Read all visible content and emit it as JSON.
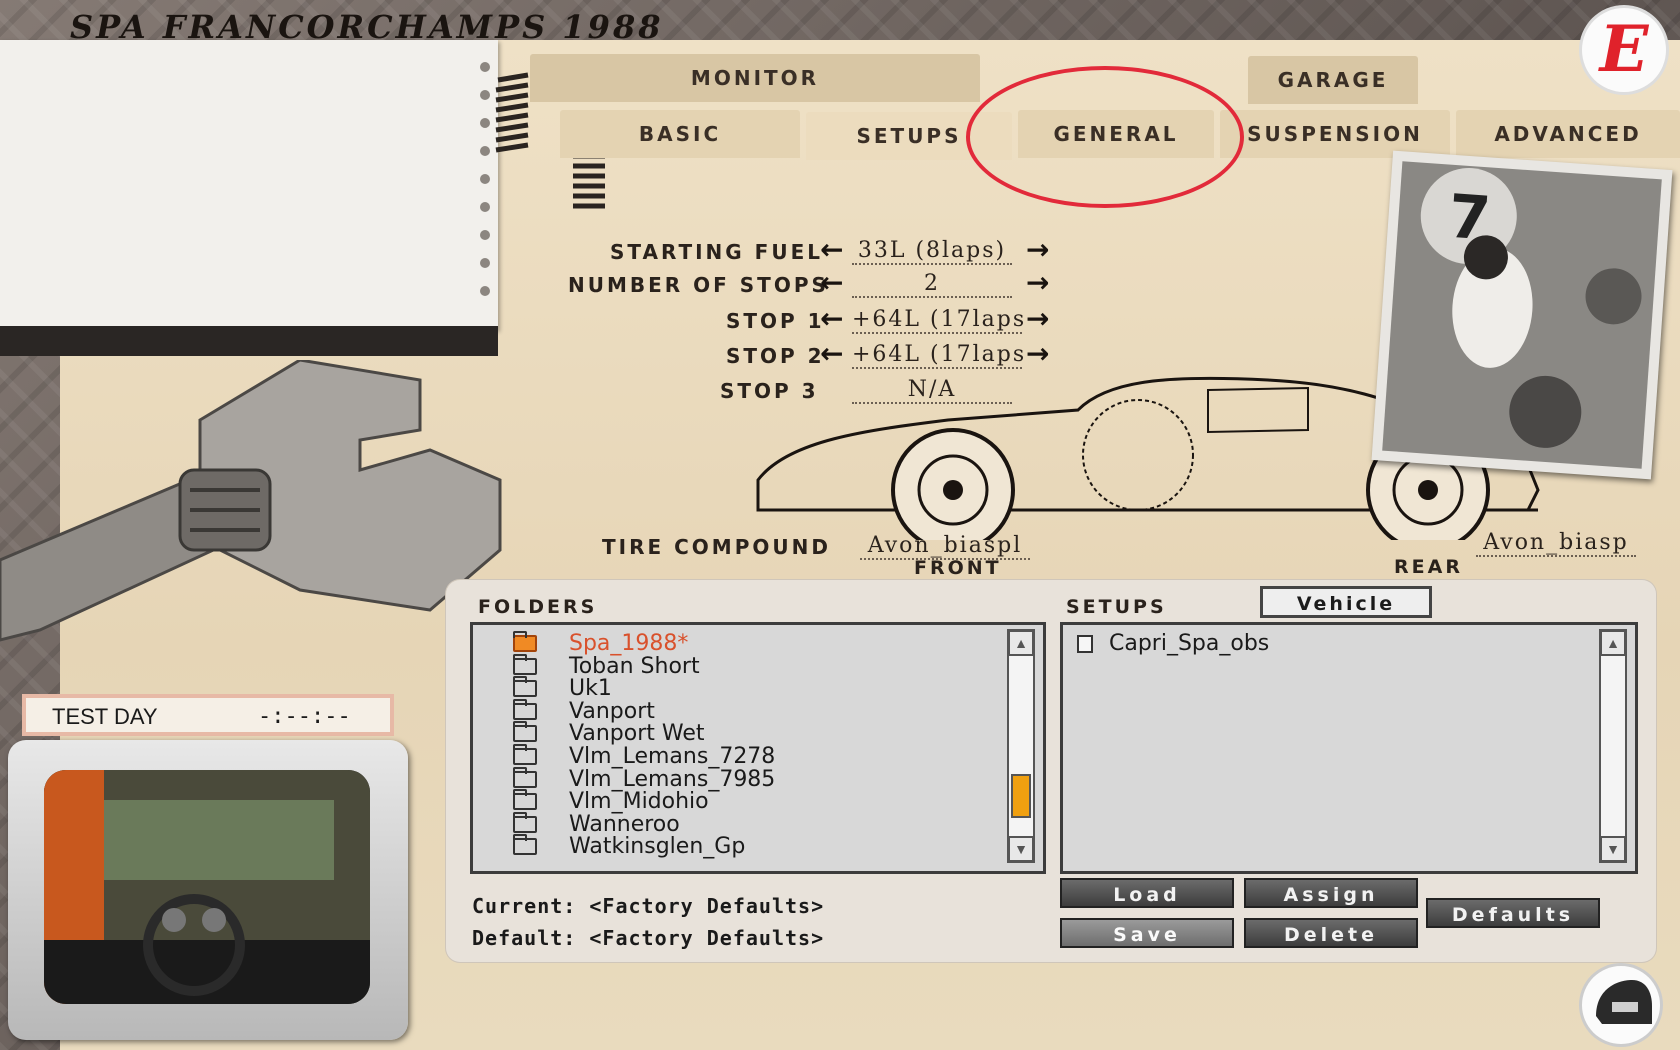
{
  "header": {
    "title": "SPA FRANCORCHAMPS 1988"
  },
  "tabs_upper": [
    {
      "label": "MONITOR"
    },
    {
      "label": "GARAGE"
    }
  ],
  "tabs_lower": [
    {
      "label": "BASIC"
    },
    {
      "label": "SETUPS"
    },
    {
      "label": "GENERAL"
    },
    {
      "label": "SUSPENSION"
    },
    {
      "label": "ADVANCED"
    }
  ],
  "settings": {
    "starting_fuel": {
      "label": "STARTING FUEL",
      "value": "33L (8laps)"
    },
    "number_of_stops": {
      "label": "NUMBER OF STOPS",
      "value": "2"
    },
    "stop1": {
      "label": "STOP 1",
      "value": "+64L (17laps"
    },
    "stop2": {
      "label": "STOP 2",
      "value": "+64L (17laps"
    },
    "stop3": {
      "label": "STOP 3",
      "value": "N/A"
    },
    "tire_compound": {
      "label": "TIRE COMPOUND",
      "front_value": "Avon_biaspl",
      "front_label": "FRONT",
      "rear_value": "Avon_biasp",
      "rear_label": "REAR"
    }
  },
  "folders": {
    "title": "FOLDERS",
    "items": [
      {
        "name": "Spa_1988*",
        "selected": true
      },
      {
        "name": "Toban Short"
      },
      {
        "name": "Uk1"
      },
      {
        "name": "Vanport"
      },
      {
        "name": "Vanport Wet"
      },
      {
        "name": "Vlm_Lemans_7278"
      },
      {
        "name": "Vlm_Lemans_7985"
      },
      {
        "name": "Vlm_Midohio"
      },
      {
        "name": "Wanneroo"
      },
      {
        "name": "Watkinsglen_Gp"
      }
    ],
    "scroll_position": 0.85
  },
  "setups": {
    "title": "SETUPS",
    "vehicle_button": "Vehicle",
    "items": [
      {
        "name": "Capri_Spa_obs"
      }
    ]
  },
  "status": {
    "current": "Current: <Factory Defaults>",
    "default": "Default: <Factory Defaults>"
  },
  "buttons": {
    "load": "Load",
    "assign": "Assign",
    "save": "Save",
    "delete": "Delete",
    "defaults": "Defaults"
  },
  "session": {
    "name": "TEST DAY",
    "time": "-:--:--"
  },
  "logo": {
    "letter": "E"
  },
  "colors": {
    "highlight_circle": "#e22a3a",
    "selected_folder": "#d9512c",
    "scroll_thumb": "#f0a010"
  }
}
